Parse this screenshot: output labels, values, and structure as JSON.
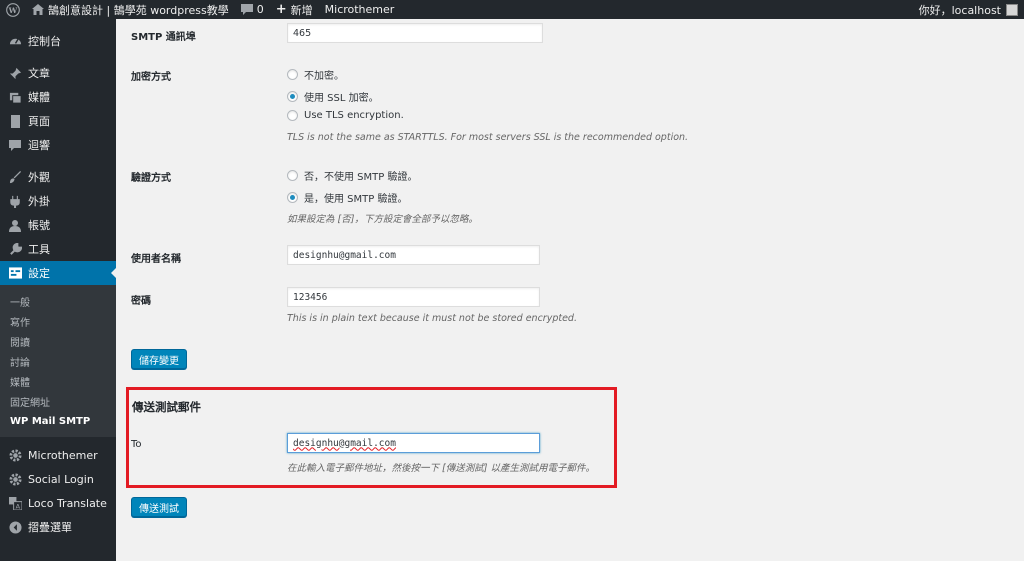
{
  "adminbar": {
    "site_title": "鵠創意設計 | 鵠學苑 wordpress教學",
    "comments_count": "0",
    "new_label": "新增",
    "microthemer_label": "Microthemer",
    "greeting": "你好，localhost"
  },
  "sidebar": {
    "items": [
      {
        "label": "控制台",
        "icon": "dashboard-icon"
      },
      {
        "label": "文章",
        "icon": "pin-icon"
      },
      {
        "label": "媒體",
        "icon": "media-icon"
      },
      {
        "label": "頁面",
        "icon": "page-icon"
      },
      {
        "label": "迴響",
        "icon": "comment-icon"
      },
      {
        "label": "外觀",
        "icon": "brush-icon"
      },
      {
        "label": "外掛",
        "icon": "plugin-icon"
      },
      {
        "label": "帳號",
        "icon": "user-icon"
      },
      {
        "label": "工具",
        "icon": "wrench-icon"
      },
      {
        "label": "設定",
        "icon": "settings-icon"
      }
    ],
    "submenu": [
      "一般",
      "寫作",
      "閱讀",
      "討論",
      "媒體",
      "固定網址",
      "WP Mail SMTP"
    ],
    "bottom_items": [
      {
        "label": "Microthemer",
        "icon": "gear-icon"
      },
      {
        "label": "Social Login",
        "icon": "gear-icon"
      },
      {
        "label": "Loco Translate",
        "icon": "translate-icon"
      },
      {
        "label": "摺疊選單",
        "icon": "collapse-icon"
      }
    ]
  },
  "form": {
    "smtp_port": {
      "label": "SMTP 通訊埠",
      "value": "465"
    },
    "encryption": {
      "label": "加密方式",
      "options": [
        "不加密。",
        "使用 SSL 加密。",
        "Use TLS encryption."
      ],
      "selected_index": 1,
      "description": "TLS is not the same as STARTTLS. For most servers SSL is the recommended option."
    },
    "authentication": {
      "label": "驗證方式",
      "options": [
        "否，不使用 SMTP 驗證。",
        "是，使用 SMTP 驗證。"
      ],
      "selected_index": 1,
      "description": "如果設定為 [否]，下方設定會全部予以忽略。"
    },
    "username": {
      "label": "使用者名稱",
      "value": "designhu@gmail.com"
    },
    "password": {
      "label": "密碼",
      "value": "123456",
      "description": "This is in plain text because it must not be stored encrypted."
    },
    "save_button": "儲存變更"
  },
  "test_email": {
    "title": "傳送測試郵件",
    "to_label": "To",
    "to_value": "designhu@gmail.com",
    "description": "在此輸入電子郵件地址，然後按一下 [傳送測試] 以產生測試用電子郵件。",
    "send_button": "傳送測試"
  }
}
